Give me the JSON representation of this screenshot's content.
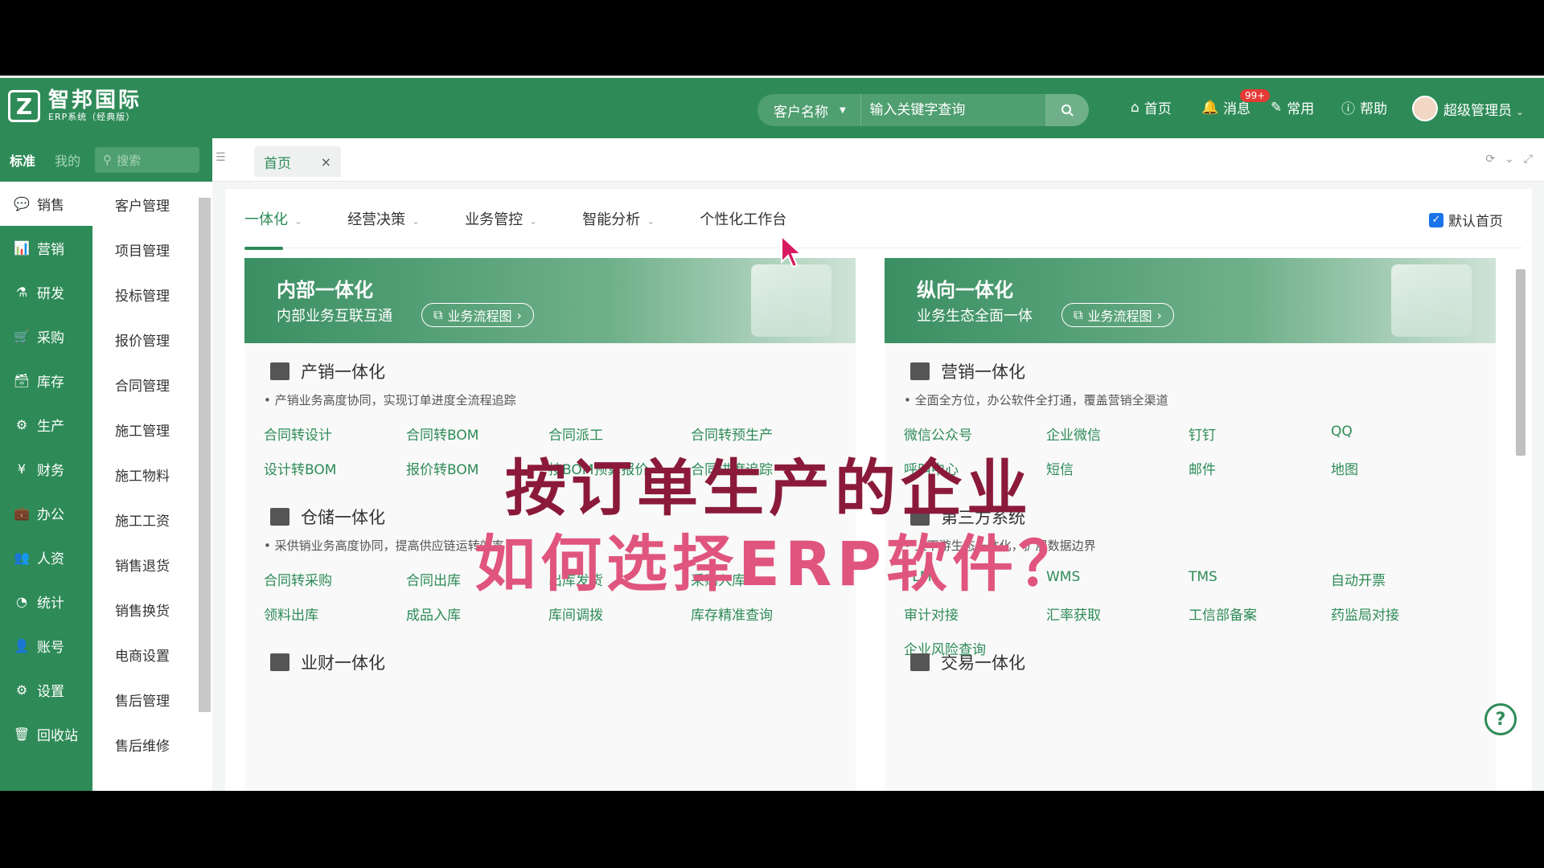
{
  "app": {
    "logo_mark": "Z",
    "logo_title": "智邦国际",
    "logo_subtitle": "ERP系统（经典版）"
  },
  "search": {
    "category": "客户名称",
    "placeholder": "输入关键字查询"
  },
  "top_nav": {
    "home": "首页",
    "messages": "消息",
    "messages_badge": "99+",
    "common": "常用",
    "help": "帮助",
    "user": "超级管理员"
  },
  "side_tabs": {
    "standard": "标准",
    "mine": "我的",
    "search_placeholder": "搜索"
  },
  "page_tab": {
    "label": "首页",
    "close": "×"
  },
  "sidebar": {
    "items": [
      {
        "label": "销售",
        "icon": "💬"
      },
      {
        "label": "营销",
        "icon": "📊"
      },
      {
        "label": "研发",
        "icon": "⚗"
      },
      {
        "label": "采购",
        "icon": "🛒"
      },
      {
        "label": "库存",
        "icon": "🗃"
      },
      {
        "label": "生产",
        "icon": "⚙"
      },
      {
        "label": "财务",
        "icon": "¥"
      },
      {
        "label": "办公",
        "icon": "💼"
      },
      {
        "label": "人资",
        "icon": "👥"
      },
      {
        "label": "统计",
        "icon": "◔"
      },
      {
        "label": "账号",
        "icon": "👤"
      },
      {
        "label": "设置",
        "icon": "⚙"
      },
      {
        "label": "回收站",
        "icon": "🗑"
      }
    ]
  },
  "submenu": {
    "items": [
      "客户管理",
      "项目管理",
      "投标管理",
      "报价管理",
      "合同管理",
      "施工管理",
      "施工物料",
      "施工工资",
      "销售退货",
      "销售换货",
      "电商设置",
      "售后管理",
      "售后维修"
    ]
  },
  "subnav": {
    "items": [
      "一体化",
      "经营决策",
      "业务管控",
      "智能分析",
      "个性化工作台"
    ],
    "default_home": "默认首页"
  },
  "panels": {
    "left": {
      "title": "内部一体化",
      "subtitle": "内部业务互联互通",
      "flow_button": "业务流程图",
      "sections": [
        {
          "title": "产销一体化",
          "desc": "• 产销业务高度协同，实现订单进度全流程追踪",
          "links": [
            "合同转设计",
            "合同转BOM",
            "合同派工",
            "合同转预生产",
            "设计转BOM",
            "报价转BOM",
            "按BOM预算报价",
            "合同进度追踪"
          ]
        },
        {
          "title": "仓储一体化",
          "desc": "• 采供销业务高度协同，提高供应链运转效率",
          "links": [
            "合同转采购",
            "合同出库",
            "出库发货",
            "采购入库",
            "领料出库",
            "成品入库",
            "库间调拨",
            "库存精准查询"
          ]
        },
        {
          "title": "业财一体化",
          "desc": "",
          "links": []
        }
      ]
    },
    "right": {
      "title": "纵向一体化",
      "subtitle": "业务生态全面一体",
      "flow_button": "业务流程图",
      "sections": [
        {
          "title": "营销一体化",
          "desc": "• 全面全方位，办公软件全打通，覆盖营销全渠道",
          "links": [
            "微信公众号",
            "企业微信",
            "钉钉",
            "QQ",
            "呼叫中心",
            "短信",
            "邮件",
            "地图"
          ]
        },
        {
          "title": "第三方系统",
          "desc": "• 上下游生态一体化，扩展数据边界",
          "links": [
            "PLM",
            "WMS",
            "TMS",
            "自动开票",
            "审计对接",
            "汇率获取",
            "工信部备案",
            "药监局对接",
            "企业风险查询"
          ]
        },
        {
          "title": "交易一体化",
          "desc": "",
          "links": []
        }
      ]
    }
  },
  "overlay": {
    "line1": "按订单生产的企业",
    "line2": "如何选择ERP软件？"
  },
  "colors": {
    "brand": "#2e8b57",
    "overlay1": "#8b1a3a",
    "overlay2": "#e0557e"
  }
}
